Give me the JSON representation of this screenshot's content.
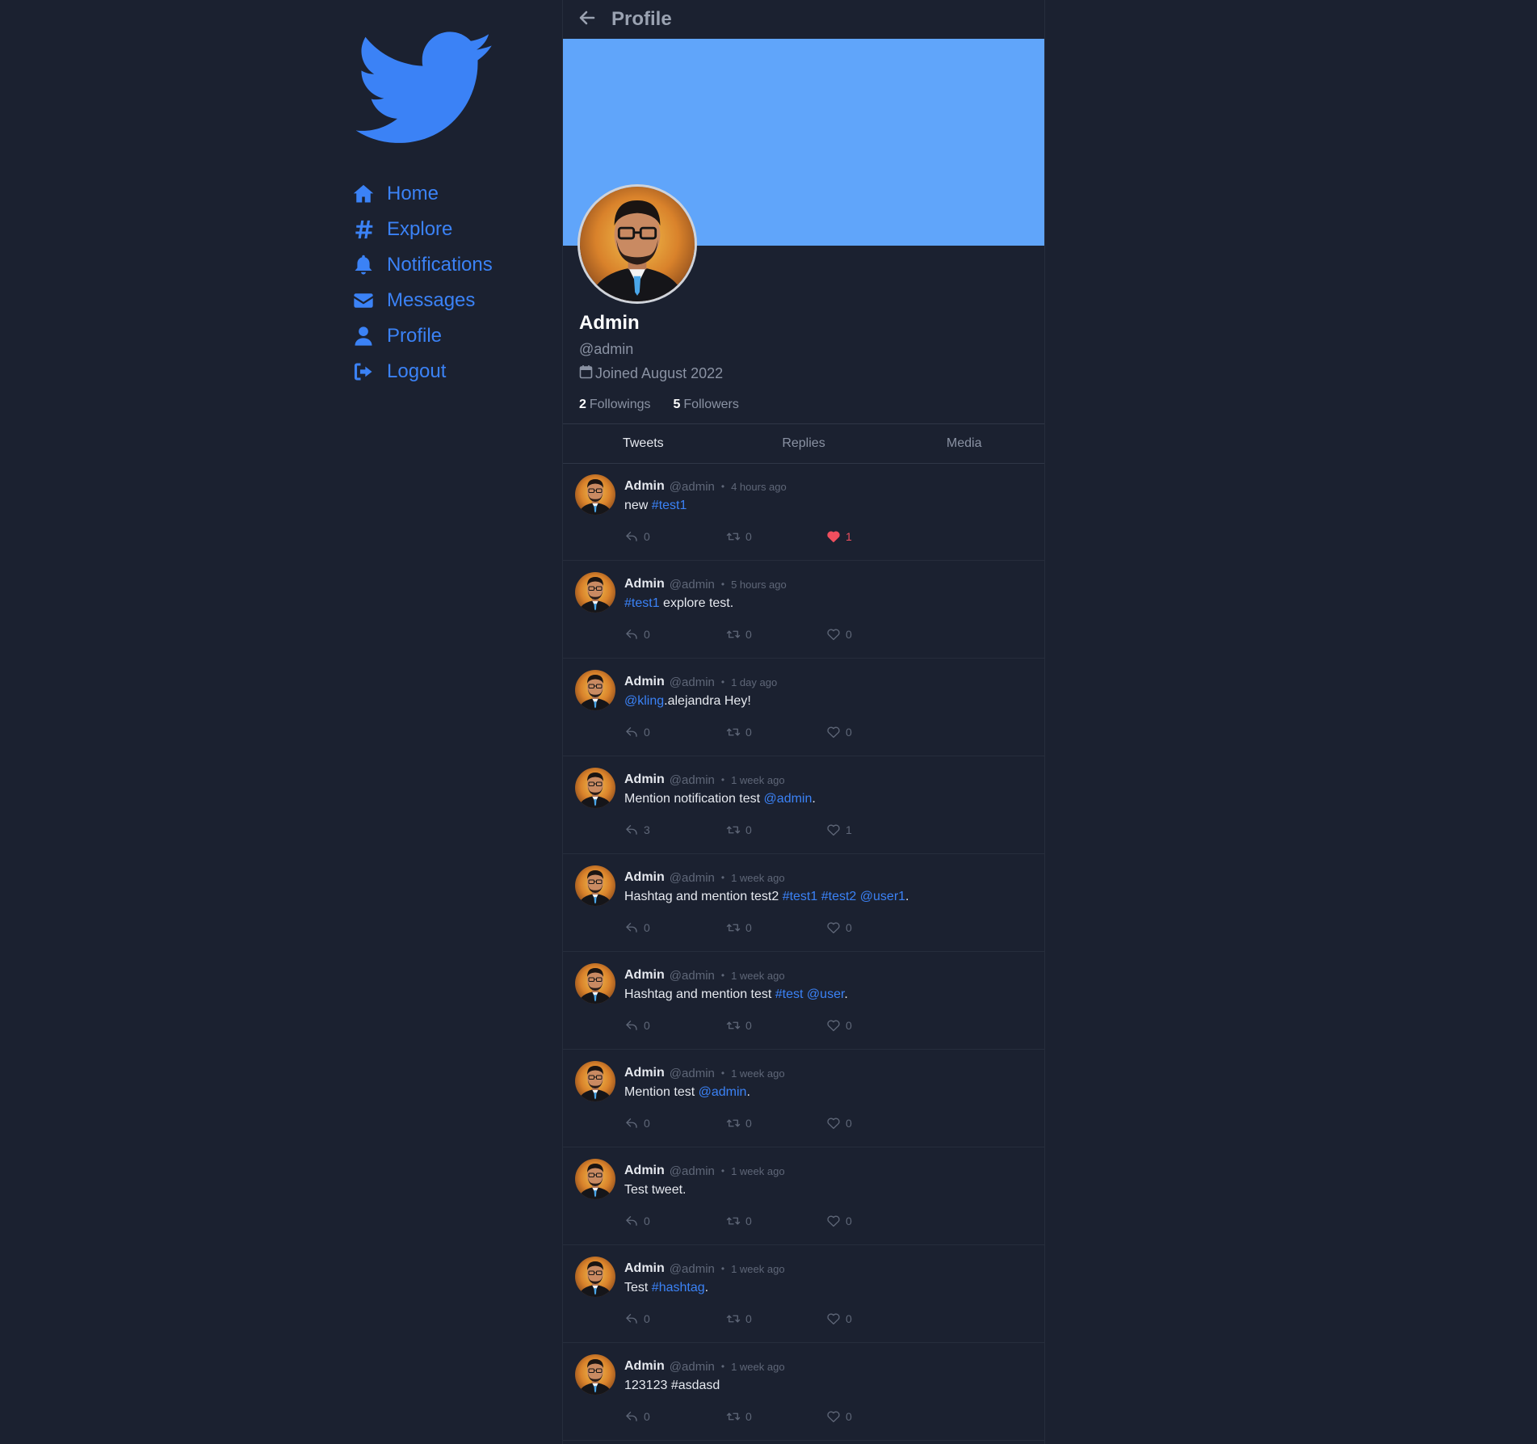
{
  "colors": {
    "accent": "#3b82f6",
    "banner": "#60a5fa",
    "background": "#1b2130",
    "like_active": "#ef4f5e"
  },
  "sidebar": {
    "logo_icon": "twitter-bird-icon",
    "items": [
      {
        "label": "Home",
        "icon": "home-icon"
      },
      {
        "label": "Explore",
        "icon": "hashtag-icon"
      },
      {
        "label": "Notifications",
        "icon": "bell-icon"
      },
      {
        "label": "Messages",
        "icon": "envelope-icon"
      },
      {
        "label": "Profile",
        "icon": "user-icon"
      },
      {
        "label": "Logout",
        "icon": "logout-icon"
      }
    ]
  },
  "header": {
    "title": "Profile",
    "back_icon": "arrow-left-icon"
  },
  "profile": {
    "name": "Admin",
    "handle": "@admin",
    "joined": "Joined August 2022",
    "followings_count": "2",
    "followings_label": "Followings",
    "followers_count": "5",
    "followers_label": "Followers"
  },
  "tabs": [
    {
      "label": "Tweets"
    },
    {
      "label": "Replies"
    },
    {
      "label": "Media"
    }
  ],
  "tweets": [
    {
      "name": "Admin",
      "handle": "@admin",
      "dot": "•",
      "time": "4 hours ago",
      "segments": [
        {
          "text": "new ",
          "link": false
        },
        {
          "text": "#test1",
          "link": true
        }
      ],
      "replies": "0",
      "retweets": "0",
      "likes": "1",
      "liked": true
    },
    {
      "name": "Admin",
      "handle": "@admin",
      "dot": "•",
      "time": "5 hours ago",
      "segments": [
        {
          "text": "#test1",
          "link": true
        },
        {
          "text": " explore test.",
          "link": false
        }
      ],
      "replies": "0",
      "retweets": "0",
      "likes": "0",
      "liked": false
    },
    {
      "name": "Admin",
      "handle": "@admin",
      "dot": "•",
      "time": "1 day ago",
      "segments": [
        {
          "text": "@kling",
          "link": true
        },
        {
          "text": ".alejandra Hey!",
          "link": false
        }
      ],
      "replies": "0",
      "retweets": "0",
      "likes": "0",
      "liked": false
    },
    {
      "name": "Admin",
      "handle": "@admin",
      "dot": "•",
      "time": "1 week ago",
      "segments": [
        {
          "text": "Mention notification test ",
          "link": false
        },
        {
          "text": "@admin",
          "link": true
        },
        {
          "text": ".",
          "link": false
        }
      ],
      "replies": "3",
      "retweets": "0",
      "likes": "1",
      "liked": false
    },
    {
      "name": "Admin",
      "handle": "@admin",
      "dot": "•",
      "time": "1 week ago",
      "segments": [
        {
          "text": "Hashtag and mention test2 ",
          "link": false
        },
        {
          "text": "#test1",
          "link": true
        },
        {
          "text": " ",
          "link": false
        },
        {
          "text": "#test2",
          "link": true
        },
        {
          "text": " ",
          "link": false
        },
        {
          "text": "@user1",
          "link": true
        },
        {
          "text": ".",
          "link": false
        }
      ],
      "replies": "0",
      "retweets": "0",
      "likes": "0",
      "liked": false
    },
    {
      "name": "Admin",
      "handle": "@admin",
      "dot": "•",
      "time": "1 week ago",
      "segments": [
        {
          "text": "Hashtag and mention test ",
          "link": false
        },
        {
          "text": "#test",
          "link": true
        },
        {
          "text": " ",
          "link": false
        },
        {
          "text": "@user",
          "link": true
        },
        {
          "text": ".",
          "link": false
        }
      ],
      "replies": "0",
      "retweets": "0",
      "likes": "0",
      "liked": false
    },
    {
      "name": "Admin",
      "handle": "@admin",
      "dot": "•",
      "time": "1 week ago",
      "segments": [
        {
          "text": "Mention test ",
          "link": false
        },
        {
          "text": "@admin",
          "link": true
        },
        {
          "text": ".",
          "link": false
        }
      ],
      "replies": "0",
      "retweets": "0",
      "likes": "0",
      "liked": false
    },
    {
      "name": "Admin",
      "handle": "@admin",
      "dot": "•",
      "time": "1 week ago",
      "segments": [
        {
          "text": "Test tweet.",
          "link": false
        }
      ],
      "replies": "0",
      "retweets": "0",
      "likes": "0",
      "liked": false
    },
    {
      "name": "Admin",
      "handle": "@admin",
      "dot": "•",
      "time": "1 week ago",
      "segments": [
        {
          "text": "Test ",
          "link": false
        },
        {
          "text": "#hashtag",
          "link": true
        },
        {
          "text": ".",
          "link": false
        }
      ],
      "replies": "0",
      "retweets": "0",
      "likes": "0",
      "liked": false
    },
    {
      "name": "Admin",
      "handle": "@admin",
      "dot": "•",
      "time": "1 week ago",
      "segments": [
        {
          "text": "123123 #asdasd",
          "link": false
        }
      ],
      "replies": "0",
      "retweets": "0",
      "likes": "0",
      "liked": false
    }
  ]
}
